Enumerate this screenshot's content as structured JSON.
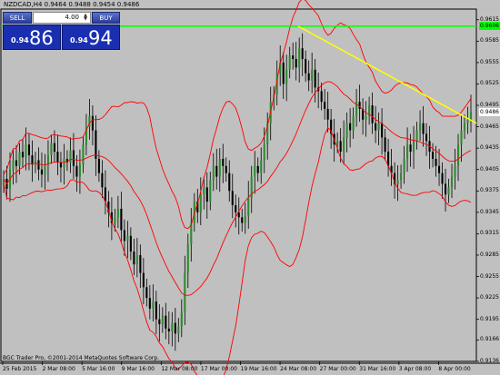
{
  "chart": {
    "title": "NZDCAD,H4  0.9464 0.9488 0.9454 0.9486",
    "copyright": "BGC Trader Pro, ©2001-2014 MetaQuotes Software Corp.",
    "current_price_label": "0.9486",
    "level_price_label": "0.9606",
    "colors": {
      "background": "#c0c0c0",
      "bull_candle": "#2e8b2e",
      "bear_candle": "#000000",
      "bands": "#ff0000",
      "horizontal_line": "#00ff00",
      "trend_line": "#ffff00"
    }
  },
  "trade_panel": {
    "sell_label": "SELL",
    "buy_label": "BUY",
    "lot_value": "4.00",
    "sell_price_small": "0.94",
    "sell_price_big": "86",
    "buy_price_small": "0.94",
    "buy_price_big": "94"
  },
  "chart_data": {
    "type": "candlestick",
    "symbol": "NZDCAD",
    "timeframe": "H4",
    "ohlc_last": {
      "open": 0.9464,
      "high": 0.9488,
      "low": 0.9454,
      "close": 0.9486
    },
    "y_ticks": [
      "0.9615",
      "0.9585",
      "0.9555",
      "0.9525",
      "0.9495",
      "0.9465",
      "0.9435",
      "0.9405",
      "0.9375",
      "0.9345",
      "0.9315",
      "0.9285",
      "0.9255",
      "0.9225",
      "0.9195",
      "0.9166",
      "0.9136"
    ],
    "x_ticks": [
      "25 Feb 2015",
      "2 Mar 08:00",
      "5 Mar 16:00",
      "9 Mar 16:00",
      "12 Mar 08:00",
      "17 Mar 00:00",
      "19 Mar 16:00",
      "24 Mar 08:00",
      "27 Mar 00:00",
      "31 Mar 16:00",
      "3 Apr 08:00",
      "8 Apr 00:00"
    ],
    "ylim": [
      0.9136,
      0.963
    ],
    "horizontal_line": 0.9606,
    "trend_line": {
      "from_price": 0.9606,
      "to_price": 0.947
    },
    "series": [
      {
        "values": [
          0.9392,
          0.9378,
          0.9405,
          0.9418,
          0.941,
          0.943,
          0.9422,
          0.944,
          0.9425,
          0.9412,
          0.9418,
          0.9405,
          0.9398,
          0.9412,
          0.9425,
          0.9442,
          0.943,
          0.9415,
          0.9408,
          0.942,
          0.9415,
          0.9432,
          0.941,
          0.9395,
          0.9412,
          0.944,
          0.9465,
          0.948,
          0.946,
          0.942,
          0.94,
          0.938,
          0.936,
          0.9345,
          0.933,
          0.9338,
          0.935,
          0.932,
          0.9305,
          0.9312,
          0.929,
          0.9272,
          0.9285,
          0.926,
          0.924,
          0.9225,
          0.921,
          0.922,
          0.9195,
          0.9188,
          0.92,
          0.9182,
          0.9178,
          0.919,
          0.9175,
          0.9185,
          0.9205,
          0.926,
          0.93,
          0.933,
          0.936,
          0.9345,
          0.937,
          0.938,
          0.936,
          0.939,
          0.941,
          0.9395,
          0.942,
          0.941,
          0.94,
          0.9375,
          0.9355,
          0.9345,
          0.9338,
          0.933,
          0.934,
          0.9365,
          0.9395,
          0.941,
          0.94,
          0.9418,
          0.944,
          0.947,
          0.95,
          0.951,
          0.954,
          0.9555,
          0.9525,
          0.9545,
          0.9565,
          0.956,
          0.9548,
          0.9575,
          0.956,
          0.954,
          0.953,
          0.9545,
          0.952,
          0.9515,
          0.95,
          0.949,
          0.9475,
          0.9455,
          0.944,
          0.9445,
          0.943,
          0.945,
          0.947,
          0.946,
          0.948,
          0.95,
          0.949,
          0.9475,
          0.948,
          0.9495,
          0.947,
          0.946,
          0.947,
          0.945,
          0.943,
          0.941,
          0.94,
          0.9385,
          0.939,
          0.94,
          0.942,
          0.944,
          0.943,
          0.9445,
          0.946,
          0.947,
          0.9455,
          0.9445,
          0.943,
          0.942,
          0.941,
          0.94,
          0.9385,
          0.937,
          0.938,
          0.9395,
          0.941,
          0.944,
          0.946,
          0.947,
          0.9475,
          0.9486
        ]
      }
    ]
  }
}
